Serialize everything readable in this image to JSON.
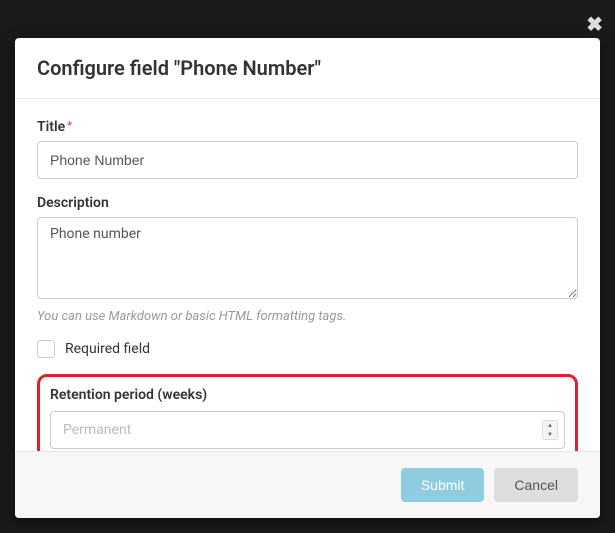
{
  "modal": {
    "title": "Configure field \"Phone Number\"",
    "close": "✖"
  },
  "form": {
    "title": {
      "label": "Title",
      "value": "Phone Number"
    },
    "description": {
      "label": "Description",
      "value": "Phone number",
      "help": "You can use Markdown or basic HTML formatting tags."
    },
    "required": {
      "label": "Required field",
      "checked": false
    },
    "retention": {
      "label": "Retention period (weeks)",
      "placeholder": "Permanent"
    }
  },
  "footer": {
    "submit": "Submit",
    "cancel": "Cancel"
  }
}
